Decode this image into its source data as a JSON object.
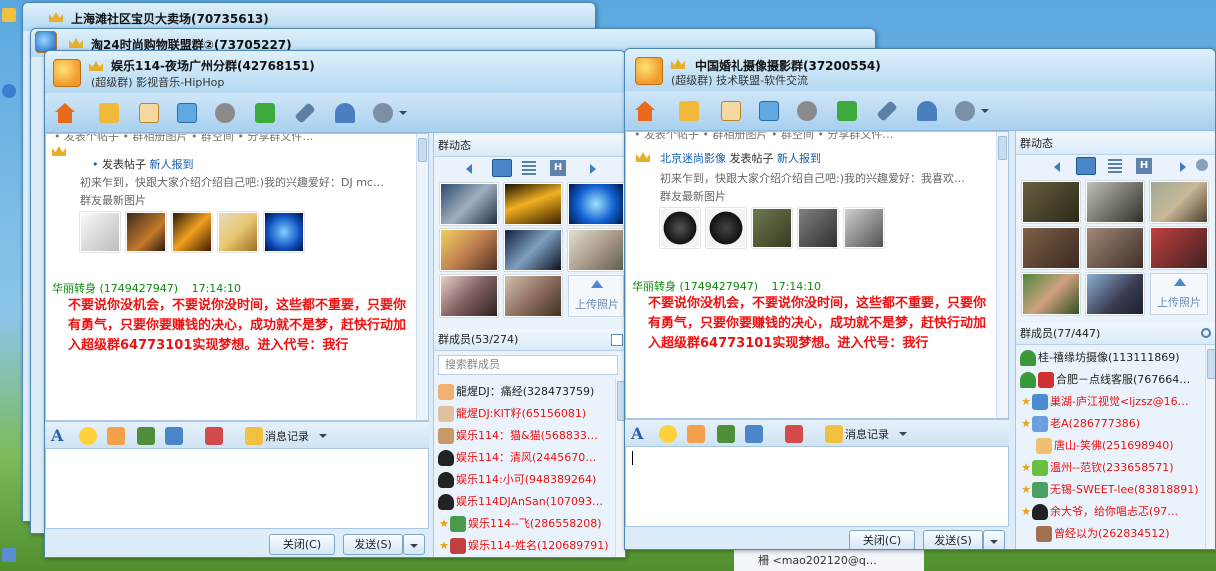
{
  "background_windows": [
    {
      "title": "上海滩社区宝贝大卖场(70735613)"
    },
    {
      "title": "淘24时尚购物联盟群②(73705227)"
    }
  ],
  "left_window": {
    "title": "娱乐114-夜场广州分群(42768151)",
    "subtitle": "(超级群) 影视音乐-HipHop",
    "feed": {
      "partial_top": "• 发表个帖子 • 群相册图片 • 群空间 • 分享群文件…",
      "post_prefix": "•",
      "post_action": "发表帖子",
      "post_link": "新人报到",
      "post_body": "初来乍到，快跟大家介绍介绍自己吧:)我的兴趣爱好：DJ mc…",
      "photos_label": "群友最新图片"
    },
    "message": {
      "sender": "华丽转身",
      "sender_id": "(1749427947)",
      "time": "17:14:10",
      "text": "不要说你没机会，不要说你没时间，这些都不重要，只要你有勇气，只要你要赚钱的决心，成功就不是梦，赶快行动加入超级群64773101实现梦想。进入代号：我行"
    },
    "input_toolbar": {
      "history_label": "消息记录"
    },
    "buttons": {
      "close": "关闭(C)",
      "send": "发送(S)"
    },
    "dynamics": {
      "title": "群动态",
      "upload": "上传照片"
    },
    "members": {
      "header": "群成员(53/274)",
      "search_placeholder": "搜索群成员",
      "list": [
        {
          "name": "龍煋DJ：痛经(328473759)",
          "color": "#222"
        },
        {
          "name": "龍煋DJ:KIT籽(65156081)",
          "color": "#e11"
        },
        {
          "name": "娱乐114：猫&猫(568833…",
          "color": "#e11"
        },
        {
          "name": "娱乐114：清风(2445670…",
          "color": "#e11"
        },
        {
          "name": "娱乐114:小可(948389264)",
          "color": "#e11"
        },
        {
          "name": "娱乐114DJAnSan(107093…",
          "color": "#e11"
        },
        {
          "name": "娱乐114--飞(286558208)",
          "color": "#e11"
        },
        {
          "name": "娱乐114-姓名(120689791)",
          "color": "#e11"
        }
      ]
    }
  },
  "right_window": {
    "title": "中国婚礼摄像摄影群(37200554)",
    "subtitle": "(超级群) 技术联盟-软件交流",
    "feed": {
      "partial_top": "• 发表个帖子 • 群相册图片 • 群空间 • 分享群文件…",
      "post_user": "北京迷尚影像",
      "post_action": "发表帖子",
      "post_link": "新人报到",
      "post_body": "初来乍到，快跟大家介绍介绍自己吧:)我的兴趣爱好：我喜欢…",
      "photos_label": "群友最新图片"
    },
    "message": {
      "sender": "华丽转身",
      "sender_id": "(1749427947)",
      "time": "17:14:10",
      "text": "不要说你没机会，不要说你没时间，这些都不重要，只要你有勇气，只要你要赚钱的决心，成功就不是梦，赶快行动加入超级群64773101实现梦想。进入代号：我行"
    },
    "input_toolbar": {
      "history_label": "消息记录"
    },
    "buttons": {
      "close": "关闭(C)",
      "send": "发送(S)"
    },
    "dynamics": {
      "title": "群动态",
      "upload": "上传照片"
    },
    "members": {
      "header": "群成员(77/447)",
      "list": [
        {
          "name": "桂-禧缘坊摄像(113111869)",
          "color": "#222"
        },
        {
          "name": "合肥－点线客服(767664…",
          "color": "#222"
        },
        {
          "name": "巢湖-庐江视觉<ljzsz@16…",
          "color": "#e11"
        },
        {
          "name": "老A(286777386)",
          "color": "#e11"
        },
        {
          "name": "唐山-笑佛(251698940)",
          "color": "#e11"
        },
        {
          "name": "温州--范钦(233658571)",
          "color": "#e11"
        },
        {
          "name": "无锡-SWEET-lee(83818891)",
          "color": "#e11"
        },
        {
          "name": "余大爷，给你唱忐忑(97…",
          "color": "#e11"
        },
        {
          "name": "曾经以为(262834512)",
          "color": "#e11"
        }
      ]
    }
  },
  "bottom_peek": {
    "text": "柵  <mao202120@q…"
  },
  "colors": {
    "accent": "#135fb0",
    "ad_red": "#e11111",
    "sender_green": "#0a8a0a",
    "chrome": "#dcecf8"
  }
}
